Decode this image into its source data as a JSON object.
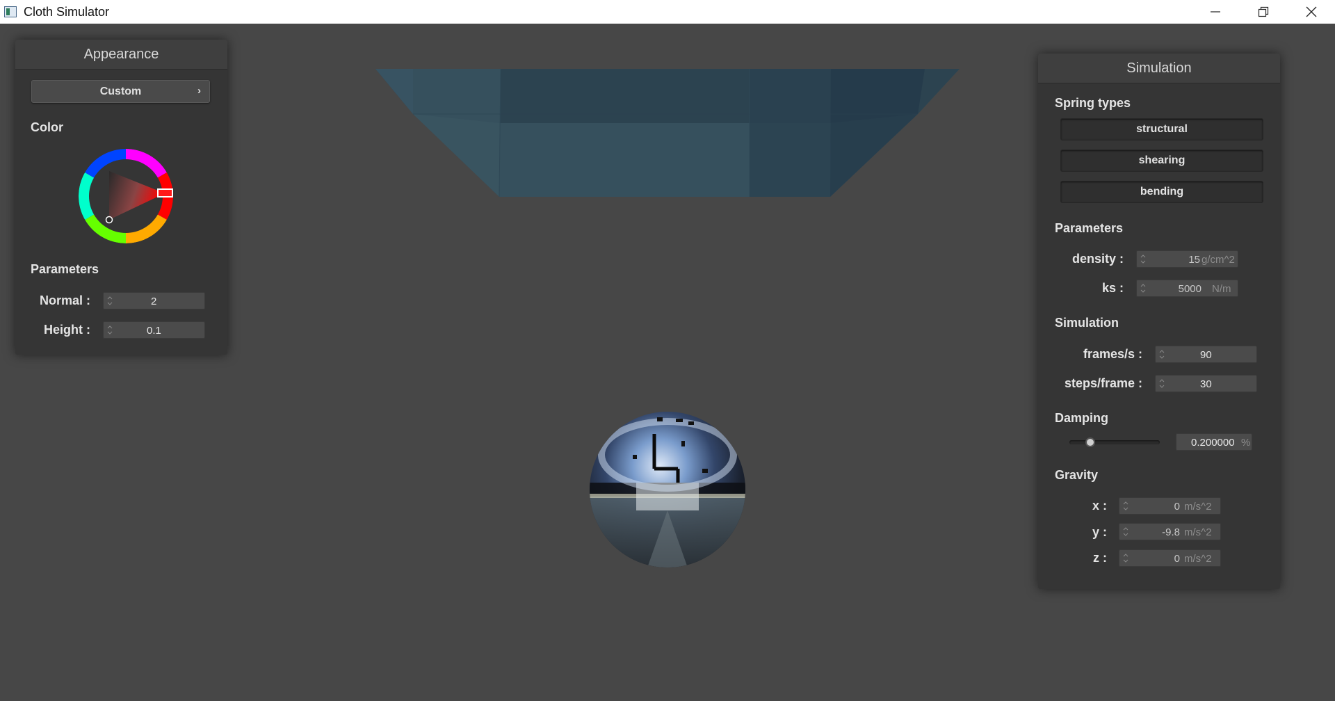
{
  "window": {
    "title": "Cloth Simulator"
  },
  "appearance_panel": {
    "title": "Appearance",
    "shader_dropdown": {
      "selected": "Custom"
    },
    "color_label": "Color",
    "color_wheel": {
      "selected_hue": "#ff1a1a"
    },
    "parameters_label": "Parameters",
    "normal": {
      "label": "Normal :",
      "value": "2"
    },
    "height": {
      "label": "Height :",
      "value": "0.1"
    }
  },
  "simulation_panel": {
    "title": "Simulation",
    "spring_types_label": "Spring types",
    "spring_buttons": [
      "structural",
      "shearing",
      "bending"
    ],
    "parameters_label": "Parameters",
    "density": {
      "label": "density :",
      "value": "15",
      "unit": "g/cm^2"
    },
    "ks": {
      "label": "ks :",
      "value": "5000",
      "unit": "N/m"
    },
    "simulation_label": "Simulation",
    "fps": {
      "label": "frames/s :",
      "value": "90"
    },
    "steps": {
      "label": "steps/frame :",
      "value": "30"
    },
    "damping_label": "Damping",
    "damping": {
      "value": "0.200000",
      "unit": "%",
      "slider_fraction": 0.2
    },
    "gravity_label": "Gravity",
    "gravity": {
      "x": {
        "label": "x :",
        "value": "0",
        "unit": "m/s^2"
      },
      "y": {
        "label": "y :",
        "value": "-9.8",
        "unit": "m/s^2"
      },
      "z": {
        "label": "z :",
        "value": "0",
        "unit": "m/s^2"
      }
    }
  },
  "colors": {
    "background": "#474747",
    "panel": "#353535",
    "cloth": "#334c5a"
  }
}
